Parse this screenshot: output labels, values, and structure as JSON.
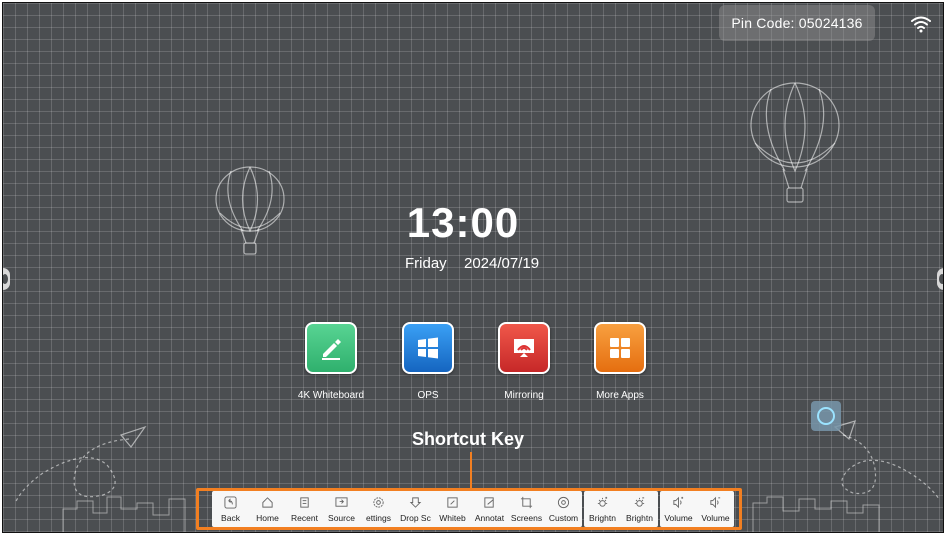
{
  "status_bar": {
    "pin_label": "Pin Code:",
    "pin_value": "05024136",
    "wifi_icon": "wifi-icon"
  },
  "clock": {
    "time": "13:00",
    "day": "Friday",
    "date": "2024/07/19"
  },
  "apps": [
    {
      "label": "4K Whiteboard",
      "icon": "pen-icon",
      "color": "#3fbf7f"
    },
    {
      "label": "OPS",
      "icon": "windows-icon",
      "color": "#1e88e5"
    },
    {
      "label": "Mirroring",
      "icon": "cast-icon",
      "color": "#e53935"
    },
    {
      "label": "More Apps",
      "icon": "grid-icon",
      "color": "#f08a24"
    }
  ],
  "shortcut": {
    "title": "Shortcut Key",
    "highlight_color": "#f27f21",
    "groups": [
      [
        {
          "label": "Back",
          "icon": "back-icon"
        },
        {
          "label": "Home",
          "icon": "home-icon"
        },
        {
          "label": "Recent",
          "icon": "recent-icon"
        },
        {
          "label": "Source",
          "icon": "source-icon"
        },
        {
          "label": "ettings",
          "icon": "settings-icon"
        },
        {
          "label": "Drop Sc",
          "icon": "drop-screen-icon"
        },
        {
          "label": "Whiteb",
          "icon": "whiteboard-icon"
        },
        {
          "label": "Annotat",
          "icon": "annotation-icon"
        },
        {
          "label": "Screens",
          "icon": "screenshot-icon"
        },
        {
          "label": "Custom",
          "icon": "custom-icon"
        }
      ],
      [
        {
          "label": "Brightn",
          "icon": "brightness-up-icon"
        },
        {
          "label": "Brightn",
          "icon": "brightness-down-icon"
        }
      ],
      [
        {
          "label": "Volume",
          "icon": "volume-up-icon"
        },
        {
          "label": "Volume",
          "icon": "volume-down-icon"
        }
      ]
    ]
  }
}
